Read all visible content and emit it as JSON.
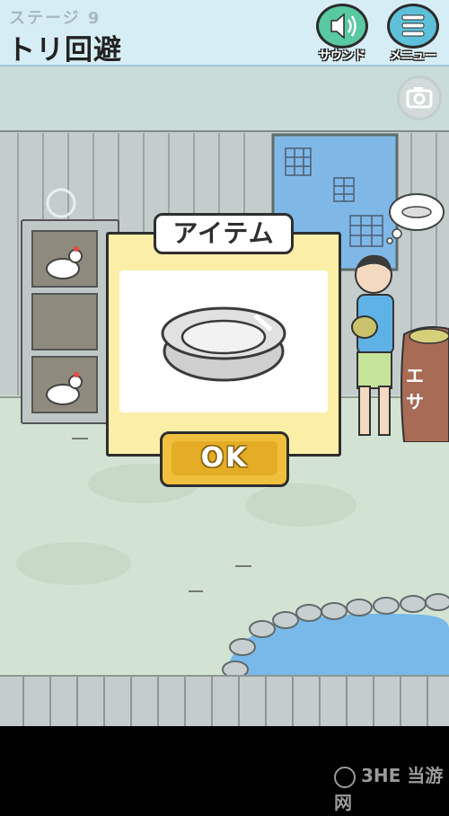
{
  "header": {
    "stage_label": "ステージ 9",
    "stage_title": "トリ回避",
    "sound_button_label": "サウンド",
    "menu_button_label": "メニュー",
    "sound_icon": "speaker-icon",
    "menu_icon": "hamburger-menu-icon",
    "camera_icon": "camera-icon"
  },
  "dialog": {
    "title": "アイテム",
    "item_icon": "pet-food-bowl-icon",
    "ok_label": "OK"
  },
  "scene": {
    "sack_label": "エサ"
  },
  "watermark": {
    "text": "3HE 当游网"
  },
  "colors": {
    "header_bg": "#d6edf5",
    "sound_button": "#59c9a2",
    "menu_button": "#5ec0d8",
    "dialog_bg": "#fbefa8",
    "ok_button": "#f0bf3e"
  }
}
